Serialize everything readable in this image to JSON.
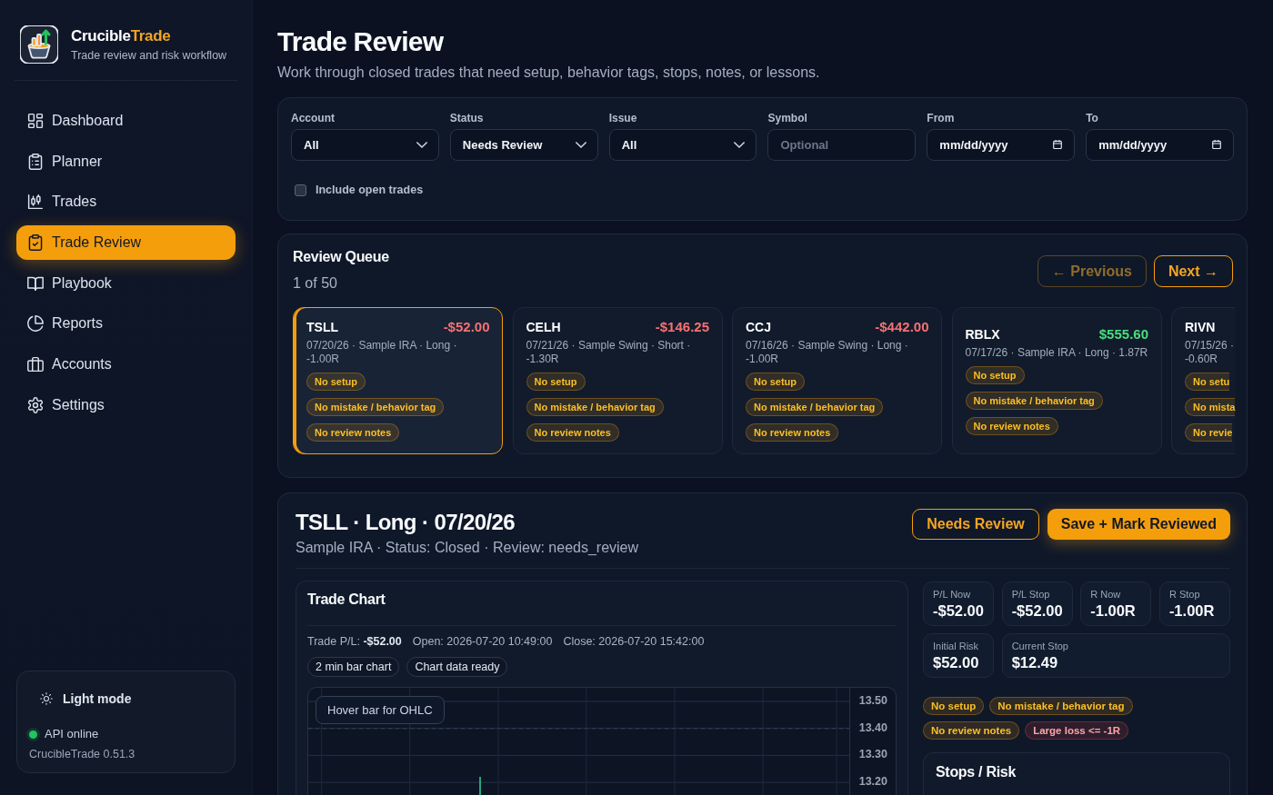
{
  "sidebar": {
    "brand": {
      "name": "Crucible",
      "accent": "Trade",
      "tagline": "Trade review and risk workflow"
    },
    "nav": [
      {
        "label": "Dashboard",
        "selected": false
      },
      {
        "label": "Planner",
        "selected": false
      },
      {
        "label": "Trades",
        "selected": false
      },
      {
        "label": "Trade Review",
        "selected": true
      },
      {
        "label": "Playbook",
        "selected": false
      },
      {
        "label": "Reports",
        "selected": false
      },
      {
        "label": "Accounts",
        "selected": false
      },
      {
        "label": "Settings",
        "selected": false
      }
    ],
    "theme_toggle": {
      "label": "Light mode"
    },
    "api_status": {
      "label": "API online",
      "online": true
    },
    "version": "CrucibleTrade 0.51.3"
  },
  "page": {
    "title": "Trade Review",
    "subtitle": "Work through closed trades that need setup, behavior tags, stops, notes, or lessons."
  },
  "filters": {
    "fields": [
      {
        "label": "Account",
        "kind": "select",
        "value": "All"
      },
      {
        "label": "Status",
        "kind": "select",
        "value": "Needs Review"
      },
      {
        "label": "Issue",
        "kind": "select",
        "value": "All"
      },
      {
        "label": "Symbol",
        "kind": "text",
        "placeholder": "Optional"
      },
      {
        "label": "From",
        "kind": "date",
        "placeholder": "mm/dd/yyyy"
      },
      {
        "label": "To",
        "kind": "date",
        "placeholder": "mm/dd/yyyy"
      }
    ],
    "include_open_trades": {
      "label": "Include open trades",
      "checked": false
    }
  },
  "review_queue": {
    "title": "Review Queue",
    "position": "1 of 50",
    "buttons": [
      {
        "label": "← Previous",
        "disabled": true
      },
      {
        "label": "Next →",
        "disabled": false
      }
    ],
    "cards": [
      {
        "symbol": "TSLL",
        "pnl": "-$52.00",
        "loss": true,
        "meta": "07/20/26 · Sample IRA · Long · -1.00R",
        "selected": true,
        "flags": [
          "No setup",
          "No mistake / behavior tag",
          "No review notes"
        ]
      },
      {
        "symbol": "CELH",
        "pnl": "-$146.25",
        "loss": true,
        "meta": "07/21/26 · Sample Swing · Short · -1.30R",
        "selected": false,
        "flags": [
          "No setup",
          "No mistake / behavior tag",
          "No review notes"
        ]
      },
      {
        "symbol": "CCJ",
        "pnl": "-$442.00",
        "loss": true,
        "meta": "07/16/26 · Sample Swing · Long · -1.00R",
        "selected": false,
        "flags": [
          "No setup",
          "No mistake / behavior tag",
          "No review notes"
        ]
      },
      {
        "symbol": "RBLX",
        "pnl": "$555.60",
        "loss": false,
        "meta": "07/17/26 · Sample IRA · Long · 1.87R",
        "selected": false,
        "flags": [
          "No setup",
          "No mistake / behavior tag",
          "No review notes"
        ]
      },
      {
        "symbol": "RIVN",
        "meta": "07/15/26 · -0.60R",
        "selected": false,
        "flags": [
          "No setu",
          "No mista",
          "No revie"
        ]
      }
    ]
  },
  "trade_detail": {
    "title": "TSLL · Long · 07/20/26",
    "subtitle": "Sample IRA · Status: Closed · Review: needs_review",
    "actions": [
      {
        "label": "Needs Review",
        "kind": "secondary"
      },
      {
        "label": "Save + Mark Reviewed",
        "kind": "primary"
      }
    ],
    "chart": {
      "title": "Trade Chart",
      "info": [
        "Trade P/L: **-$52.00**",
        "Open: 2026-07-20 10:49:00",
        "Close: 2026-07-20 15:42:00"
      ],
      "tags": [
        "2 min bar chart",
        "Chart data ready"
      ],
      "tooltip": "Hover bar for OHLC",
      "y_axis_labels": [
        "13.50",
        "13.40",
        "13.30",
        "13.20"
      ]
    },
    "stats": [
      {
        "label": "P/L Now",
        "value": "-$52.00"
      },
      {
        "label": "P/L Stop",
        "value": "-$52.00"
      },
      {
        "label": "R Now",
        "value": "-1.00R"
      },
      {
        "label": "R Stop",
        "value": "-1.00R"
      },
      {
        "label": "Initial Risk",
        "value": "$52.00"
      },
      {
        "label": "Current Stop",
        "value": "$12.49"
      }
    ],
    "flags": [
      {
        "label": "No setup",
        "kind": "warning"
      },
      {
        "label": "No mistake / behavior tag",
        "kind": "warning"
      },
      {
        "label": "No review notes",
        "kind": "warning"
      },
      {
        "label": "Large loss <= -1R",
        "kind": "danger"
      }
    ],
    "stops_risk": {
      "title": "Stops / Risk"
    }
  }
}
